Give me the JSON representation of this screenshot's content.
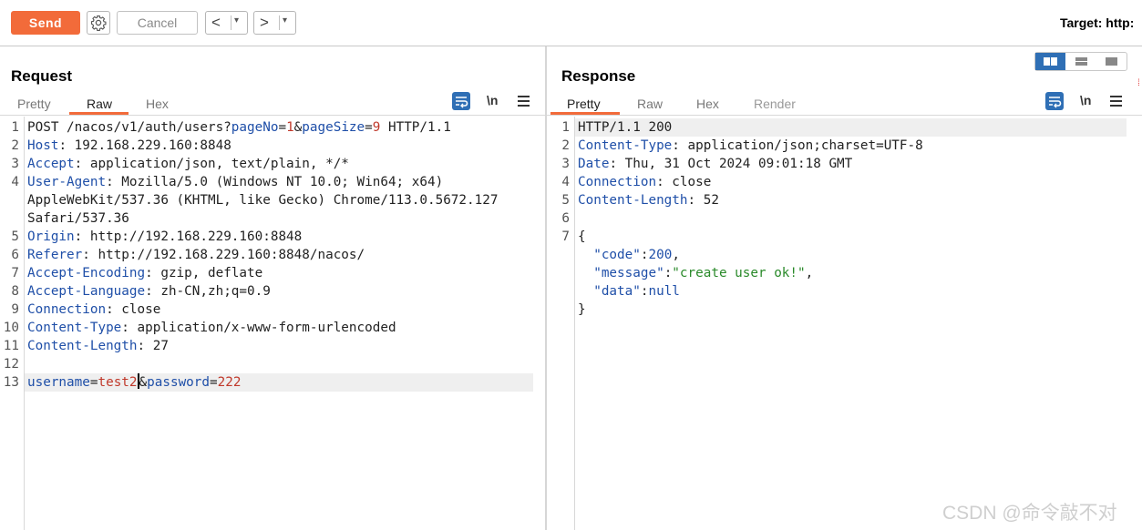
{
  "toolbar": {
    "send_label": "Send",
    "cancel_label": "Cancel",
    "back_glyph": "<",
    "forward_glyph": ">",
    "dropdown_glyph": "▾",
    "target_label": "Target: http:"
  },
  "request": {
    "title": "Request",
    "tabs": [
      "Pretty",
      "Raw",
      "Hex"
    ],
    "active_tab": "Raw",
    "newline_toggle": "\\n",
    "line_numbers": [
      "1",
      "2",
      "3",
      "4",
      "5",
      "6",
      "7",
      "8",
      "9",
      "10",
      "11",
      "12",
      "13"
    ],
    "lines": [
      {
        "parts": [
          {
            "t": "POST /nacos/v1/auth/users?",
            "c": "v"
          },
          {
            "t": "pageNo",
            "c": "k"
          },
          {
            "t": "=",
            "c": "v"
          },
          {
            "t": "1",
            "c": "num"
          },
          {
            "t": "&",
            "c": "v"
          },
          {
            "t": "pageSize",
            "c": "k"
          },
          {
            "t": "=",
            "c": "v"
          },
          {
            "t": "9",
            "c": "num"
          },
          {
            "t": " HTTP/1.1",
            "c": "v"
          }
        ]
      },
      {
        "parts": [
          {
            "t": "Host",
            "c": "k"
          },
          {
            "t": ": 192.168.229.160:8848",
            "c": "v"
          }
        ]
      },
      {
        "parts": [
          {
            "t": "Accept",
            "c": "k"
          },
          {
            "t": ": application/json, text/plain, */*",
            "c": "v"
          }
        ]
      },
      {
        "parts": [
          {
            "t": "User-Agent",
            "c": "k"
          },
          {
            "t": ": Mozilla/5.0 (Windows NT 10.0; Win64; x64)",
            "c": "v"
          }
        ]
      },
      {
        "parts": [
          {
            "t": "AppleWebKit/537.36 (KHTML, like Gecko) Chrome/113.0.5672.127",
            "c": "v"
          }
        ]
      },
      {
        "parts": [
          {
            "t": "Safari/537.36",
            "c": "v"
          }
        ]
      },
      {
        "parts": [
          {
            "t": "Origin",
            "c": "k"
          },
          {
            "t": ": http://192.168.229.160:8848",
            "c": "v"
          }
        ]
      },
      {
        "parts": [
          {
            "t": "Referer",
            "c": "k"
          },
          {
            "t": ": http://192.168.229.160:8848/nacos/",
            "c": "v"
          }
        ]
      },
      {
        "parts": [
          {
            "t": "Accept-Encoding",
            "c": "k"
          },
          {
            "t": ": gzip, deflate",
            "c": "v"
          }
        ]
      },
      {
        "parts": [
          {
            "t": "Accept-Language",
            "c": "k"
          },
          {
            "t": ": zh-CN,zh;q=0.9",
            "c": "v"
          }
        ]
      },
      {
        "parts": [
          {
            "t": "Connection",
            "c": "k"
          },
          {
            "t": ": close",
            "c": "v"
          }
        ]
      },
      {
        "parts": [
          {
            "t": "Content-Type",
            "c": "k"
          },
          {
            "t": ": application/x-www-form-urlencoded",
            "c": "v"
          }
        ]
      },
      {
        "parts": [
          {
            "t": "Content-Length",
            "c": "k"
          },
          {
            "t": ": 27",
            "c": "v"
          }
        ]
      },
      {
        "parts": []
      },
      {
        "parts": [
          {
            "t": "username",
            "c": "k"
          },
          {
            "t": "=",
            "c": "v"
          },
          {
            "t": "test2",
            "c": "num"
          },
          {
            "t": "CARET",
            "c": "caret"
          },
          {
            "t": "&",
            "c": "v"
          },
          {
            "t": "password",
            "c": "k"
          },
          {
            "t": "=",
            "c": "v"
          },
          {
            "t": "222",
            "c": "num"
          }
        ]
      }
    ]
  },
  "response": {
    "title": "Response",
    "tabs": [
      "Pretty",
      "Raw",
      "Hex",
      "Render"
    ],
    "active_tab": "Pretty",
    "newline_toggle": "\\n",
    "line_numbers": [
      "1",
      "2",
      "3",
      "4",
      "5",
      "6",
      "7"
    ],
    "lines": [
      {
        "parts": [
          {
            "t": "HTTP/1.1 200",
            "c": "v"
          }
        ]
      },
      {
        "parts": [
          {
            "t": "Content-Type",
            "c": "k"
          },
          {
            "t": ": application/json;charset=UTF-8",
            "c": "v"
          }
        ]
      },
      {
        "parts": [
          {
            "t": "Date",
            "c": "k"
          },
          {
            "t": ": Thu, 31 Oct 2024 09:01:18 GMT",
            "c": "v"
          }
        ]
      },
      {
        "parts": [
          {
            "t": "Connection",
            "c": "k"
          },
          {
            "t": ": close",
            "c": "v"
          }
        ]
      },
      {
        "parts": [
          {
            "t": "Content-Length",
            "c": "k"
          },
          {
            "t": ": 52",
            "c": "v"
          }
        ]
      },
      {
        "parts": []
      },
      {
        "parts": [
          {
            "t": "{",
            "c": "v"
          }
        ]
      },
      {
        "parts": [
          {
            "t": "  ",
            "c": "v"
          },
          {
            "t": "\"code\"",
            "c": "rk"
          },
          {
            "t": ":",
            "c": "v"
          },
          {
            "t": "200",
            "c": "rk"
          },
          {
            "t": ",",
            "c": "v"
          }
        ]
      },
      {
        "parts": [
          {
            "t": "  ",
            "c": "v"
          },
          {
            "t": "\"message\"",
            "c": "rk"
          },
          {
            "t": ":",
            "c": "v"
          },
          {
            "t": "\"create user ok!\"",
            "c": "str"
          },
          {
            "t": ",",
            "c": "v"
          }
        ]
      },
      {
        "parts": [
          {
            "t": "  ",
            "c": "v"
          },
          {
            "t": "\"data\"",
            "c": "rk"
          },
          {
            "t": ":",
            "c": "v"
          },
          {
            "t": "null",
            "c": "rk"
          }
        ]
      },
      {
        "parts": [
          {
            "t": "}",
            "c": "v"
          }
        ]
      }
    ]
  },
  "watermark": "CSDN @命令敲不对",
  "colors": {
    "accent": "#f26b3a",
    "key_blue": "#1f4fa8",
    "value_red": "#c0392b",
    "string_green": "#2a8a2a",
    "icon_blue": "#2f6fb5"
  }
}
